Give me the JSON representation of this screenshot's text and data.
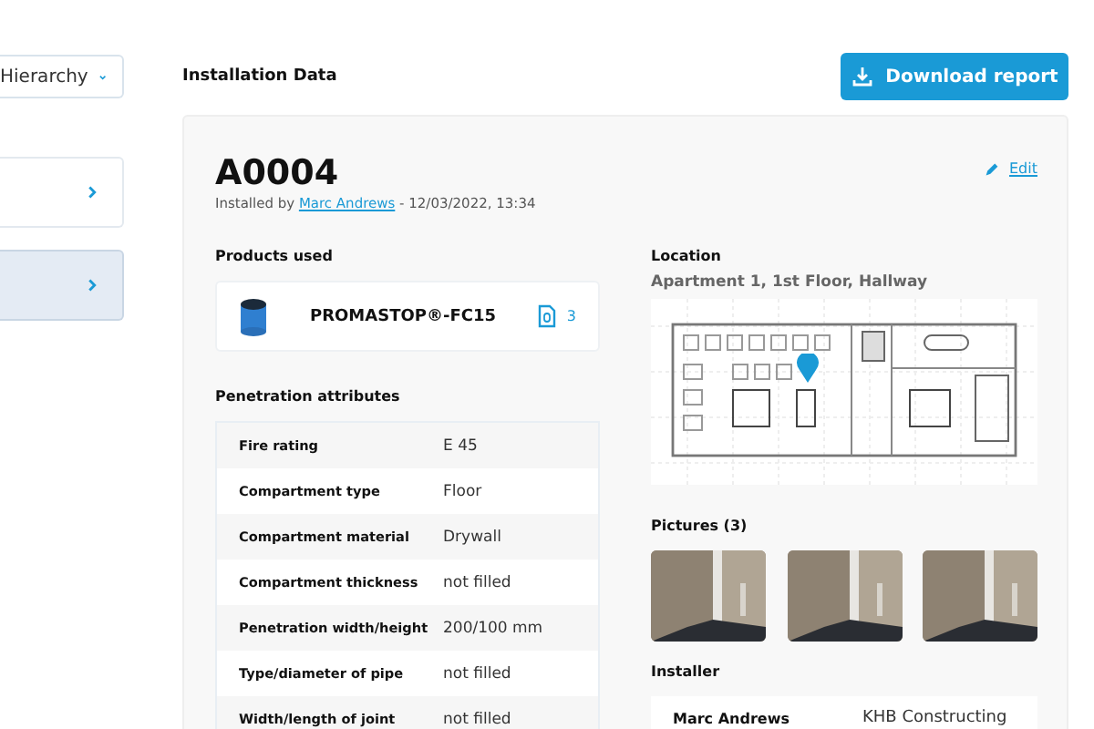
{
  "sidebar": {
    "hierarchy_dropdown": {
      "label": "Hierarchy"
    },
    "items": [
      {
        "selected": false
      },
      {
        "selected": true
      }
    ]
  },
  "header": {
    "title": "Installation Data",
    "download_button": "Download report"
  },
  "record": {
    "id": "A0004",
    "installed_prefix": "Installed by",
    "installer_link": "Marc Andrews",
    "installed_suffix": "- 12/03/2022, 13:34",
    "edit_button": "Edit"
  },
  "products": {
    "heading": "Products used",
    "items": [
      {
        "name": "PROMASTOP®-FC15",
        "documents": "3"
      }
    ]
  },
  "penetration": {
    "heading": "Penetration attributes",
    "rows": [
      {
        "label": "Fire rating",
        "value": "E 45"
      },
      {
        "label": "Compartment type",
        "value": "Floor"
      },
      {
        "label": "Compartment material",
        "value": "Drywall"
      },
      {
        "label": "Compartment thickness",
        "value": "not filled"
      },
      {
        "label": "Penetration width/height",
        "value": "200/100 mm"
      },
      {
        "label": "Type/diameter of pipe",
        "value": "not filled"
      },
      {
        "label": "Width/length of joint",
        "value": "not filled"
      }
    ]
  },
  "location": {
    "heading": "Location",
    "address": "Apartment 1, 1st Floor, Hallway"
  },
  "pictures": {
    "heading": "Pictures (3)"
  },
  "installer": {
    "heading": "Installer",
    "rows": [
      {
        "name": "Marc Andrews",
        "company": "KHB Constructing"
      }
    ]
  }
}
